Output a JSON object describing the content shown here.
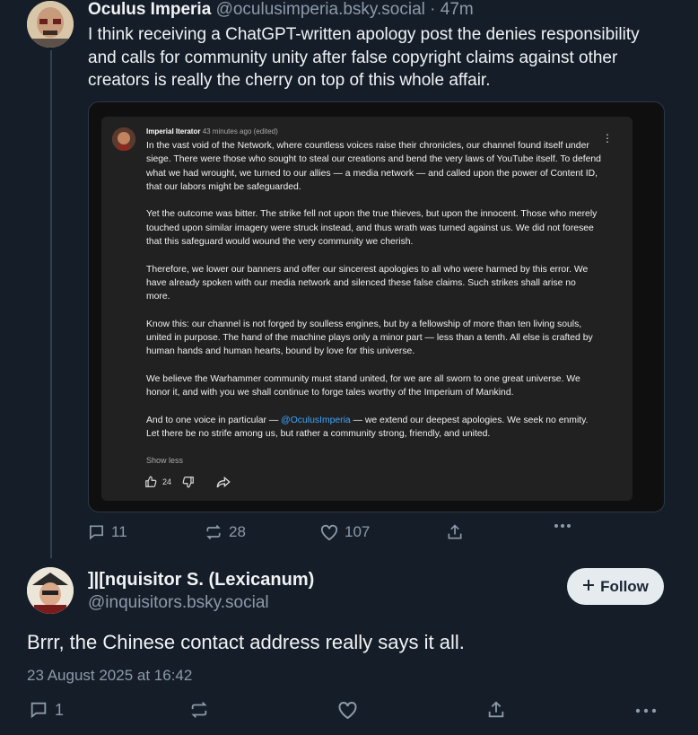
{
  "post1": {
    "author_name": "Oculus Imperia",
    "author_handle": "@oculusimperia.bsky.social",
    "separator": "·",
    "time": "47m",
    "text": "I think receiving a ChatGPT-written apology post the denies responsibility and calls for community unity after false copyright claims against other creators is really the cherry on top of this whole affair.",
    "embed": {
      "author": "Imperial Iterator",
      "meta": "43 minutes ago (edited)",
      "paragraphs": [
        "In the vast void of the Network, where countless voices raise their chronicles, our channel found itself under siege. There were those who sought to steal our creations and bend the very laws of YouTube itself. To defend what we had wrought, we turned to our allies — a media network — and called upon the power of Content ID, that our labors might be safeguarded.",
        "Yet the outcome was bitter. The strike fell not upon the true thieves, but upon the innocent. Those who merely touched upon similar imagery were struck instead, and thus wrath was turned against us. We did not foresee that this safeguard would wound the very community we cherish.",
        "Therefore, we lower our banners and offer our sincerest apologies to all who were harmed by this error. We have already spoken with our media network and silenced these false claims. Such strikes shall arise no more.",
        "Know this: our channel is not forged by soulless engines, but by a fellowship of more than ten living souls, united in purpose. The hand of the machine plays only a minor part — less than a tenth. All else is crafted by human hands and human hearts, bound by love for this universe.",
        "We believe the Warhammer community must stand united, for we are all sworn to one great universe. We honor it, and with you we shall continue to forge tales worthy of the Imperium of Mankind."
      ],
      "last_before": "And to one voice in particular — ",
      "mention": "@OculusImperia",
      "last_after": " — we extend our deepest apologies. We seek no enmity. Let there be no strife among us, but rather a community strong, friendly, and united.",
      "show_less": "Show less",
      "likes": "24"
    },
    "replies": "11",
    "reposts": "28",
    "likes": "107"
  },
  "post2": {
    "author_name": "]|[nquisitor S. (Lexicanum)",
    "author_handle": "@inquisitors.bsky.social",
    "follow_label": "Follow",
    "text": "Brrr, the Chinese contact address really says it all.",
    "date": "23 August 2025 at 16:42",
    "replies": "1"
  },
  "colors": {
    "background": "#151d28",
    "muted": "#8c9aab",
    "mention": "#3ea6ff",
    "follow_bg": "#e6ebf0"
  },
  "icons": [
    "reply-icon",
    "repost-icon",
    "like-icon",
    "share-icon",
    "more-icon",
    "thumbs-up-icon",
    "thumbs-down-icon",
    "plus-icon"
  ]
}
